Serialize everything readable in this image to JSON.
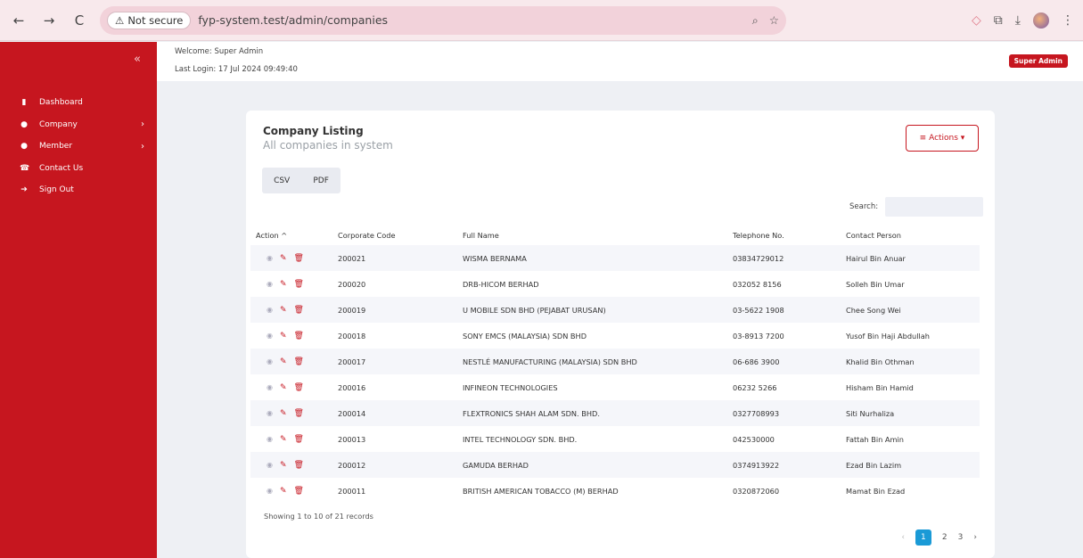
{
  "browser": {
    "back_icon": "←",
    "forward_icon": "→",
    "reload_icon": "C",
    "not_secure_label": "Not secure",
    "url": "fyp-system.test/admin/companies"
  },
  "sidebar": {
    "collapse_glyph": "«",
    "items": [
      {
        "label": "Dashboard",
        "icon": "▮",
        "has_sub": false
      },
      {
        "label": "Company",
        "icon": "●",
        "has_sub": true
      },
      {
        "label": "Member",
        "icon": "●",
        "has_sub": true
      },
      {
        "label": "Contact Us",
        "icon": "☎",
        "has_sub": false
      },
      {
        "label": "Sign Out",
        "icon": "➔",
        "has_sub": false
      }
    ]
  },
  "topbar": {
    "welcome": "Welcome: Super Admin",
    "last_login": "Last Login: 17 Jul 2024 09:49:40",
    "role_badge": "Super Admin"
  },
  "card": {
    "title": "Company Listing",
    "subtitle": "All companies in system",
    "actions_label": "≡ Actions ▾",
    "csv_label": "CSV",
    "pdf_label": "PDF",
    "search_label": "Search:",
    "columns": [
      "Action ^",
      "Corporate Code",
      "Full Name",
      "Telephone No.",
      "Contact Person"
    ],
    "rows": [
      [
        "200021",
        "WISMA BERNAMA",
        "03834729012",
        "Hairul Bin Anuar"
      ],
      [
        "200020",
        "DRB-HICOM BERHAD",
        "032052 8156",
        "Solleh Bin Umar"
      ],
      [
        "200019",
        "U MOBILE SDN BHD (PEJABAT URUSAN)",
        "03-5622 1908",
        "Chee Song Wei"
      ],
      [
        "200018",
        "SONY EMCS (MALAYSIA) SDN BHD",
        "03-8913 7200",
        "Yusof Bin Haji Abdullah"
      ],
      [
        "200017",
        "NESTLÉ MANUFACTURING (MALAYSIA) SDN BHD",
        "06-686 3900",
        "Khalid Bin Othman"
      ],
      [
        "200016",
        "INFINEON TECHNOLOGIES",
        "06232 5266",
        "Hisham Bin Hamid"
      ],
      [
        "200014",
        "FLEXTRONICS SHAH ALAM SDN. BHD.",
        "0327708993",
        "Siti Nurhaliza"
      ],
      [
        "200013",
        "INTEL TECHNOLOGY SDN. BHD.",
        "042530000",
        "Fattah Bin Amin"
      ],
      [
        "200012",
        "GAMUDA BERHAD",
        "0374913922",
        "Ezad Bin Lazim"
      ],
      [
        "200011",
        "BRITISH AMERICAN TOBACCO (M) BERHAD",
        "0320872060",
        "Mamat Bin Ezad"
      ]
    ],
    "info": "Showing 1 to 10 of 21 records",
    "pages": [
      "1",
      "2",
      "3"
    ],
    "prev_glyph": "‹",
    "next_glyph": "›"
  },
  "colors": {
    "brand": "#c6161f",
    "page_active": "#1a9ad6"
  }
}
